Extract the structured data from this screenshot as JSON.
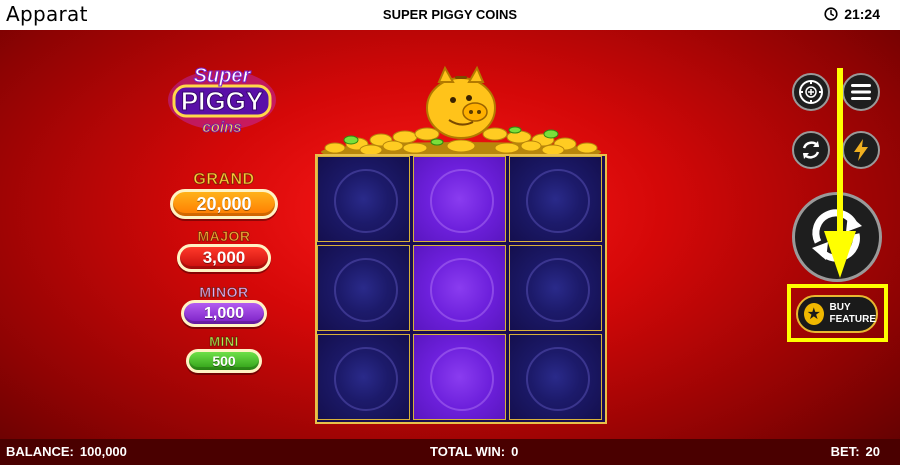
{
  "top_bar": {
    "brand": "Apparat",
    "game_title": "SUPER PIGGY COINS",
    "time": "21:24"
  },
  "logo": {
    "line1": "Super",
    "line2": "PIGGY",
    "line3": "coins"
  },
  "jackpots": [
    {
      "label": "GRAND",
      "value": "20,000",
      "color": "#ff8c00"
    },
    {
      "label": "MAJOR",
      "value": "3,000",
      "color": "#d81515"
    },
    {
      "label": "MINOR",
      "value": "1,000",
      "color": "#8a2bd6"
    },
    {
      "label": "MINI",
      "value": "500",
      "color": "#3fae20"
    }
  ],
  "reels": {
    "columns": 3,
    "rows": 3,
    "highlighted_column": 2
  },
  "controls": {
    "buy_feature_label_1": "BUY",
    "buy_feature_label_2": "FEATURE",
    "highlight_color": "#ffff00"
  },
  "bottom_bar": {
    "balance_label": "BALANCE:",
    "balance_value": "100,000",
    "total_win_label": "TOTAL WIN:",
    "total_win_value": "0",
    "bet_label": "BET:",
    "bet_value": "20"
  }
}
